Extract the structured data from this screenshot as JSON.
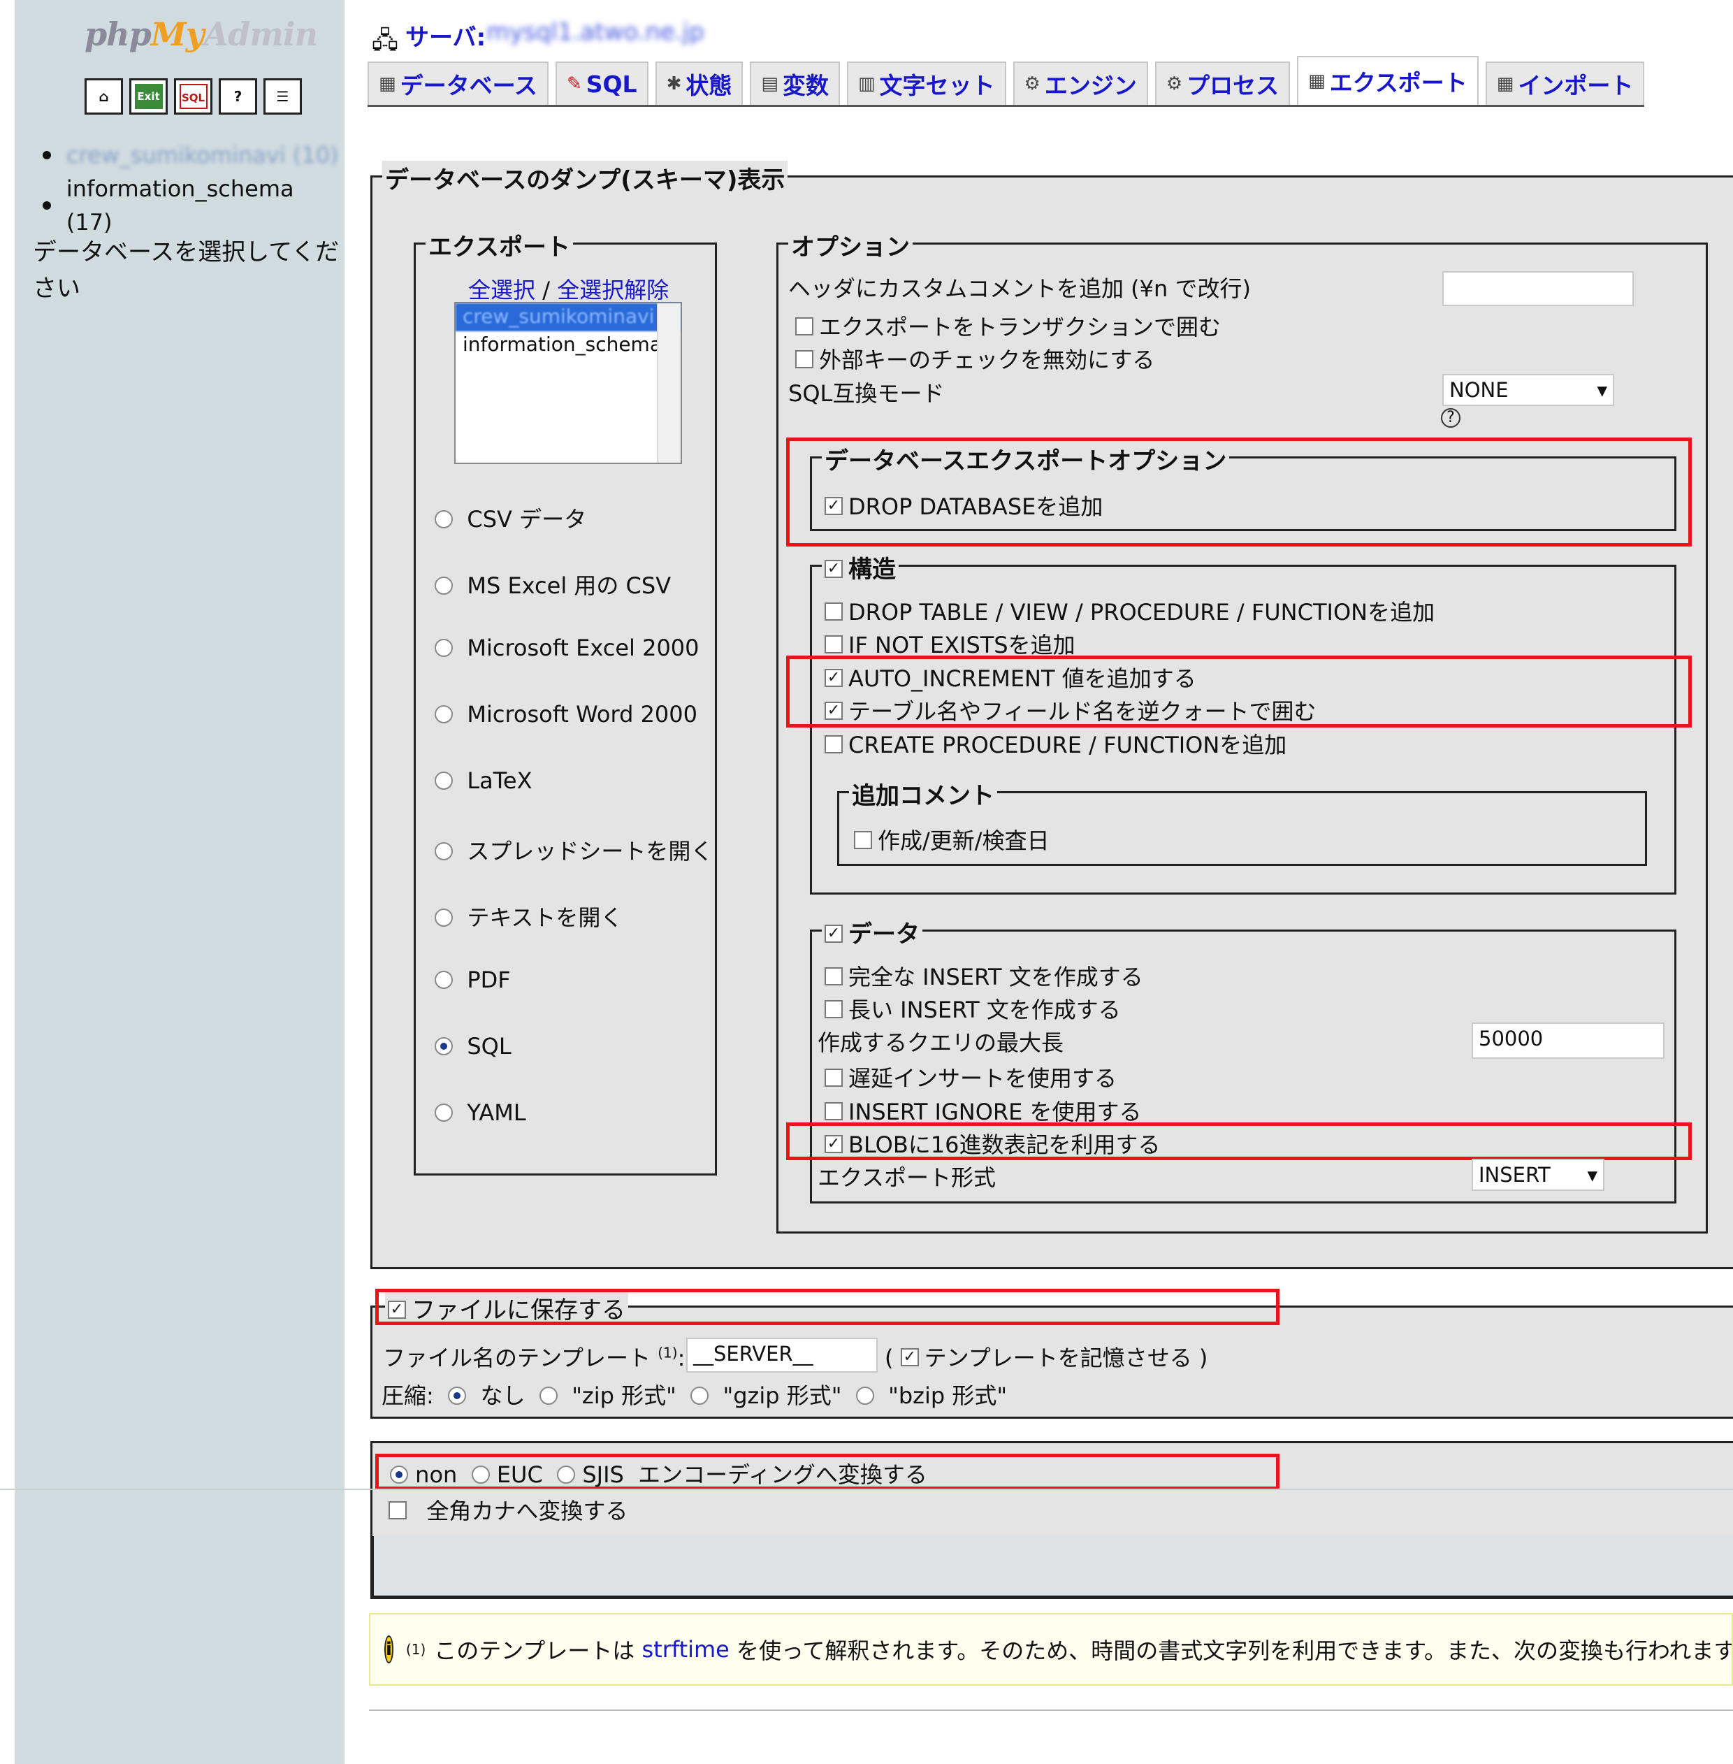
{
  "sidebar": {
    "logo": {
      "php": "php",
      "my": "My",
      "admin": "Admin"
    },
    "icons": [
      "home-icon",
      "exit-icon",
      "sql-icon",
      "help-icon",
      "docs-icon"
    ],
    "icon_labels": {
      "exit": "Exit",
      "sql": "SQL"
    },
    "databases": [
      {
        "name": "crew_sumikominavi (10)",
        "blurred": true
      },
      {
        "name": "information_schema (17)",
        "blurred": false
      }
    ],
    "select_prompt": "データベースを選択してください"
  },
  "header": {
    "server_label": "サーバ:",
    "server_host": "mysql1.atwo.ne.jp"
  },
  "tabs": [
    {
      "label": "データベース",
      "icon": "database-icon"
    },
    {
      "label": "SQL",
      "icon": "sql-icon"
    },
    {
      "label": "状態",
      "icon": "status-icon"
    },
    {
      "label": "変数",
      "icon": "variables-icon"
    },
    {
      "label": "文字セット",
      "icon": "charset-icon"
    },
    {
      "label": "エンジン",
      "icon": "engine-icon"
    },
    {
      "label": "プロセス",
      "icon": "process-icon"
    },
    {
      "label": "エクスポート",
      "icon": "export-icon",
      "active": true
    },
    {
      "label": "インポート",
      "icon": "import-icon"
    }
  ],
  "dump": {
    "legend": "データベースのダンプ(スキーマ)表示",
    "export": {
      "legend": "エクスポート",
      "select_all": "全選択",
      "separator": "/",
      "deselect_all": "全選択解除",
      "db_options": [
        "crew_sumikominavi",
        "information_schema"
      ],
      "formats": [
        {
          "label": "CSV データ",
          "selected": false
        },
        {
          "label": "MS Excel 用の CSV",
          "selected": false
        },
        {
          "label": "Microsoft Excel 2000",
          "selected": false
        },
        {
          "label": "Microsoft Word 2000",
          "selected": false
        },
        {
          "label": "LaTeX",
          "selected": false
        },
        {
          "label": "スプレッドシートを開く",
          "selected": false
        },
        {
          "label": "テキストを開く",
          "selected": false
        },
        {
          "label": "PDF",
          "selected": false
        },
        {
          "label": "SQL",
          "selected": true
        },
        {
          "label": "YAML",
          "selected": false
        }
      ]
    },
    "options": {
      "legend": "オプション",
      "header_comment_label": "ヘッダにカスタムコメントを追加 (¥n で改行)",
      "header_comment_value": "",
      "transaction_label": "エクスポートをトランザクションで囲む",
      "transaction_checked": false,
      "fk_label": "外部キーのチェックを無効にする",
      "fk_checked": false,
      "compat_label": "SQL互換モード",
      "compat_value": "NONE",
      "help_glyph": "?",
      "db_export": {
        "legend": "データベースエクスポートオプション",
        "drop_db_label": "DROP DATABASEを追加",
        "drop_db_checked": true
      },
      "structure": {
        "legend": "構造",
        "checked": true,
        "items": [
          {
            "label": "DROP TABLE / VIEW / PROCEDURE / FUNCTIONを追加",
            "checked": false
          },
          {
            "label": "IF NOT EXISTSを追加",
            "checked": false
          },
          {
            "label": "AUTO_INCREMENT 値を追加する",
            "checked": true
          },
          {
            "label": "テーブル名やフィールド名を逆クォートで囲む",
            "checked": true
          },
          {
            "label": "CREATE PROCEDURE / FUNCTIONを追加",
            "checked": false
          }
        ],
        "comments": {
          "legend": "追加コメント",
          "label": "作成/更新/検査日",
          "checked": false
        }
      },
      "data": {
        "legend": "データ",
        "checked": true,
        "complete_insert": {
          "label": "完全な INSERT 文を作成する",
          "checked": false
        },
        "extended_insert": {
          "label": "長い INSERT 文を作成する",
          "checked": false
        },
        "max_query_label": "作成するクエリの最大長",
        "max_query_value": "50000",
        "delayed": {
          "label": "遅延インサートを使用する",
          "checked": false
        },
        "ignore": {
          "label": "INSERT IGNORE を使用する",
          "checked": false
        },
        "hex_blob": {
          "label": "BLOBに16進数表記を利用する",
          "checked": true
        },
        "export_type_label": "エクスポート形式",
        "export_type_value": "INSERT"
      }
    }
  },
  "save": {
    "legend": "ファイルに保存する",
    "checked": true,
    "template_label": "ファイル名のテンプレート",
    "template_sup": "(1)",
    "template_colon": ":",
    "template_value": "__SERVER__",
    "remember_open": "(",
    "remember_label": "テンプレートを記憶させる",
    "remember_close": ")",
    "remember_checked": true,
    "compression_label": "圧縮:",
    "compression": [
      {
        "label": "なし",
        "selected": true
      },
      {
        "label": "\"zip 形式\"",
        "selected": false
      },
      {
        "label": "\"gzip 形式\"",
        "selected": false
      },
      {
        "label": "\"bzip 形式\"",
        "selected": false
      }
    ]
  },
  "encoding": {
    "options": [
      {
        "label": "non",
        "selected": true
      },
      {
        "label": "EUC",
        "selected": false
      },
      {
        "label": "SJIS",
        "selected": false
      }
    ],
    "suffix": "エンコーディングへ変換する",
    "kana_label": "全角カナへ変換する",
    "kana_checked": false
  },
  "note": {
    "icon_glyph": "i",
    "sup": "(1)",
    "text_before": "このテンプレートは",
    "link": "strftime",
    "text_after": "を使って解釈されます。そのため、時間の書式文字列を利用できます。また、次の変換も行われます。"
  },
  "colors": {
    "link": "#1818c8",
    "highlight": "#e8141a",
    "sidebar": "#d0dce0",
    "fieldset": "#e4e4e4"
  }
}
